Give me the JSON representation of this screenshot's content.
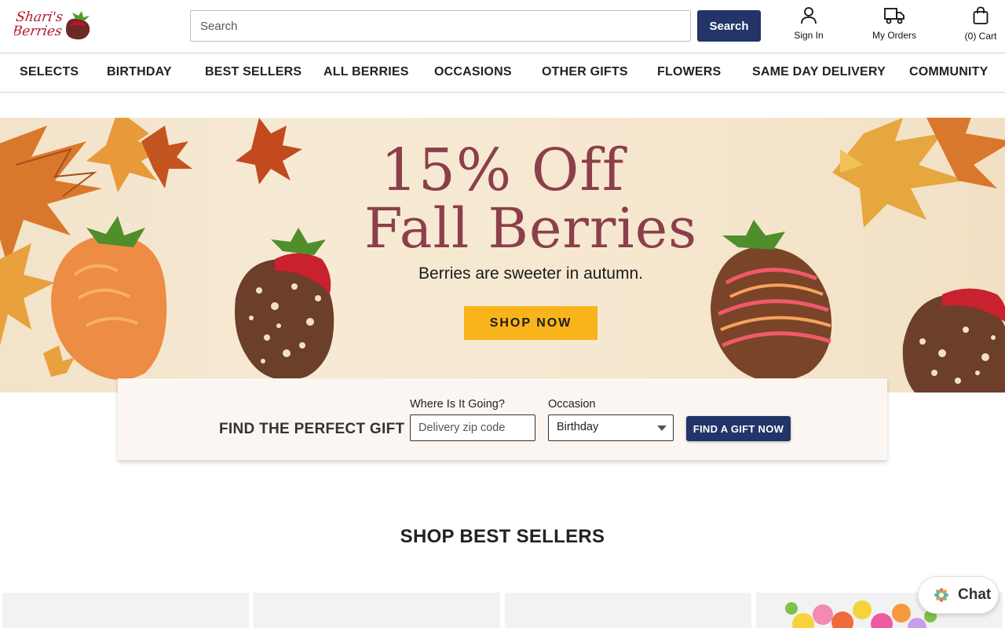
{
  "header": {
    "logo_text": "Shari's Berries",
    "search": {
      "placeholder": "Search",
      "button_label": "Search"
    },
    "actions": {
      "sign_in": {
        "label": "Sign In",
        "icon": "user-icon"
      },
      "orders": {
        "label": "My Orders",
        "icon": "truck-icon"
      },
      "cart": {
        "label": "(0) Cart",
        "icon": "shopping-bag-icon"
      }
    }
  },
  "nav": {
    "items": [
      {
        "label": "SELECTS"
      },
      {
        "label": "BIRTHDAY"
      },
      {
        "label": "BEST SELLERS"
      },
      {
        "label": "ALL BERRIES"
      },
      {
        "label": "OCCASIONS"
      },
      {
        "label": "OTHER GIFTS"
      },
      {
        "label": "FLOWERS"
      },
      {
        "label": "SAME DAY DELIVERY"
      },
      {
        "label": "COMMUNITY"
      }
    ]
  },
  "hero": {
    "headline_line1": "15% Off",
    "headline_line2": "Fall Berries",
    "subheadline": "Berries are sweeter in autumn.",
    "cta_label": "SHOP NOW"
  },
  "gift_finder": {
    "title": "FIND THE PERFECT GIFT",
    "zip_label": "Where Is It Going?",
    "zip_placeholder": "Delivery zip code",
    "occasion_label": "Occasion",
    "occasion_value": "Birthday",
    "button_label": "FIND A GIFT NOW"
  },
  "best_sellers": {
    "title": "SHOP BEST SELLERS"
  },
  "chat": {
    "label": "Chat",
    "icon": "chat-flower-icon"
  },
  "colors": {
    "primary_navy": "#223468",
    "cta_yellow": "#f8b41a",
    "headline_maroon": "#8c3f4a",
    "brand_red": "#b5172e"
  }
}
